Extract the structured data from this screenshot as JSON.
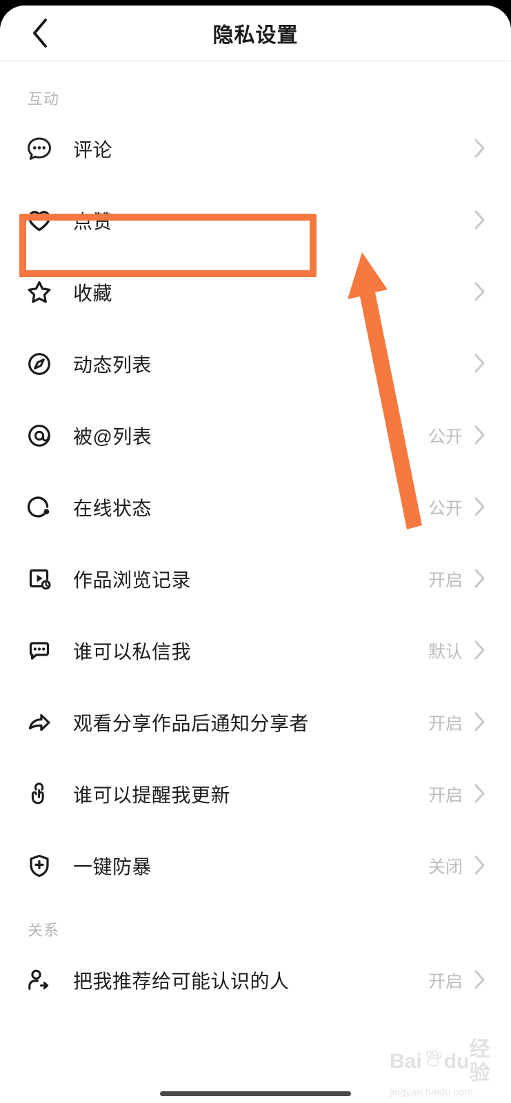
{
  "header": {
    "title": "隐私设置",
    "back_icon": "chevron-left-icon"
  },
  "sections": [
    {
      "label": "互动",
      "items": [
        {
          "icon": "comment-icon",
          "label": "评论",
          "value": ""
        },
        {
          "icon": "heart-icon",
          "label": "点赞",
          "value": ""
        },
        {
          "icon": "star-icon",
          "label": "收藏",
          "value": ""
        },
        {
          "icon": "compass-icon",
          "label": "动态列表",
          "value": ""
        },
        {
          "icon": "at-mention-icon",
          "label": "被@列表",
          "value": "公开"
        },
        {
          "icon": "online-status-icon",
          "label": "在线状态",
          "value": "公开"
        },
        {
          "icon": "play-history-icon",
          "label": "作品浏览记录",
          "value": "开启"
        },
        {
          "icon": "message-icon",
          "label": "谁可以私信我",
          "value": "默认"
        },
        {
          "icon": "share-arrow-icon",
          "label": "观看分享作品后通知分享者",
          "value": "开启"
        },
        {
          "icon": "tap-hand-icon",
          "label": "谁可以提醒我更新",
          "value": "开启"
        },
        {
          "icon": "shield-plus-icon",
          "label": "一键防暴",
          "value": "关闭"
        }
      ]
    },
    {
      "label": "关系",
      "items": [
        {
          "icon": "person-add-icon",
          "label": "把我推荐给可能认识的人",
          "value": "开启"
        }
      ]
    }
  ],
  "annotations": {
    "highlight_target": "点赞",
    "highlight_color": "#F4783F",
    "arrow_color": "#F4783F"
  },
  "watermark": {
    "brand_left": "Bai",
    "brand_right": "du",
    "brand_suffix": "经验",
    "url": "jingyan.baidu.com"
  },
  "colors": {
    "accent_orange": "#F4783F",
    "text_primary": "#1d1d1d",
    "text_muted": "#bdbdbd",
    "section_label": "#b6b6b6"
  }
}
